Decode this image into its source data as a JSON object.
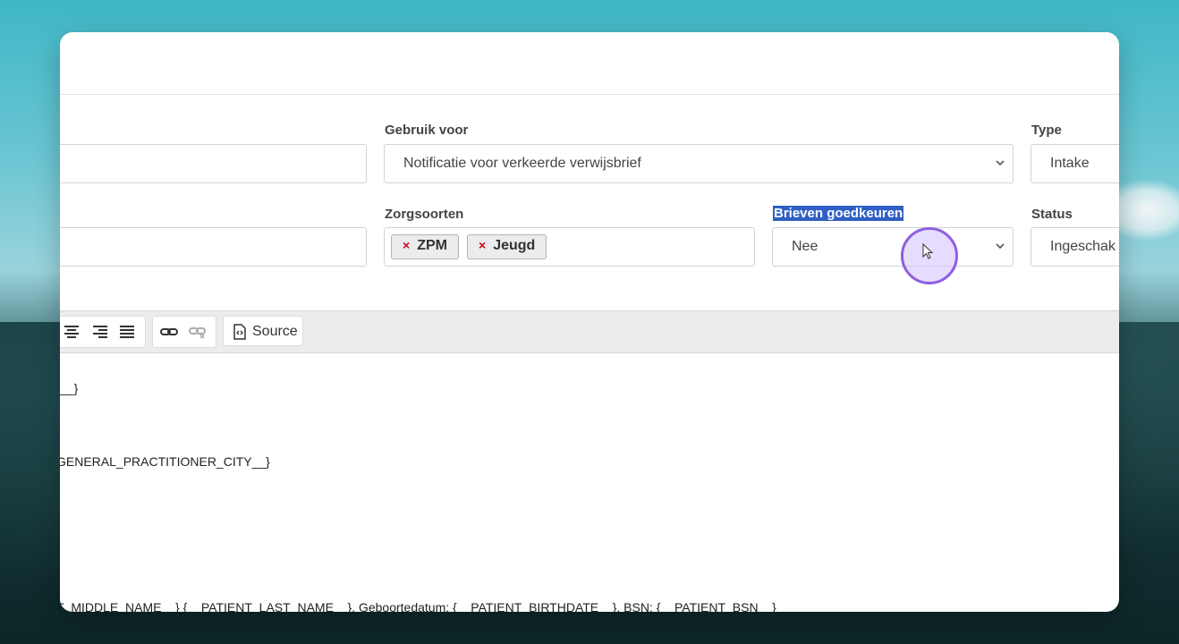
{
  "form": {
    "gebruik_voor": {
      "label": "Gebruik voor",
      "value": "Notificatie voor verkeerde verwijsbrief"
    },
    "type": {
      "label": "Type",
      "value": "Intake"
    },
    "zorgsoorten": {
      "label": "Zorgsoorten",
      "chips": [
        "ZPM",
        "Jeugd"
      ],
      "remove_symbol": "×"
    },
    "brieven_goedkeuren": {
      "label": "Brieven goedkeuren",
      "value": "Nee"
    },
    "status": {
      "label": "Status",
      "value": "Ingeschak"
    }
  },
  "toolbar": {
    "icons": [
      "align-center-icon",
      "align-right-icon",
      "align-justify-icon",
      "link-icon",
      "unlink-icon",
      "source-icon"
    ],
    "source_label": "Source"
  },
  "editor": {
    "lines": [
      "__}",
      "GENERAL_PRACTITIONER_CITY__}",
      "T_MIDDLE_NAME__} {__PATIENT_LAST_NAME__}, Geboortedatum: {__PATIENT_BIRTHDATE__}, BSN: {__PATIENT_BSN__}"
    ]
  },
  "colors": {
    "label_highlight": "#2f5fc4",
    "chip_remove": "#d0021b",
    "cursor_ring": "#8f5fe0"
  }
}
